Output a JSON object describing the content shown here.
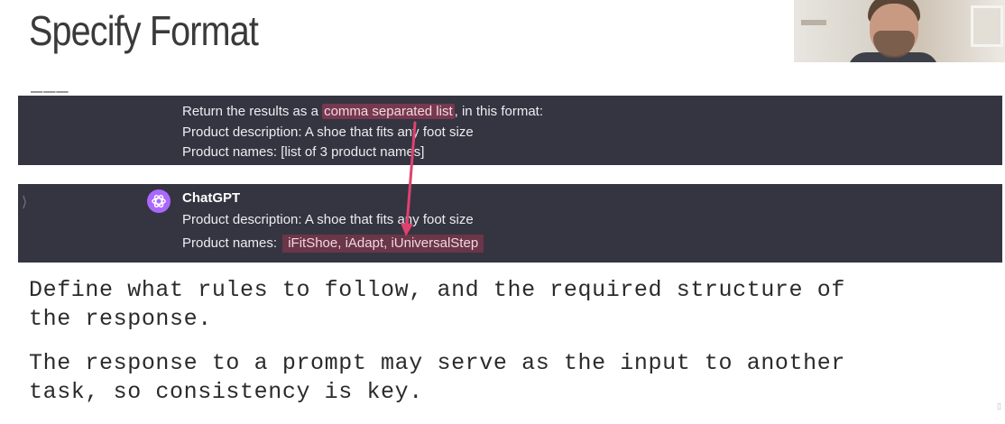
{
  "slide": {
    "title": "Specify Format",
    "rule": "___"
  },
  "user_message": {
    "line1_pre": "Return the results as a ",
    "line1_highlight": "comma separated list",
    "line1_post": ", in this format:",
    "line2": "Product description: A shoe that fits any foot size",
    "line3": "Product names: [list of 3 product names]"
  },
  "assistant_message": {
    "sidebar_glyph": "⟩",
    "sender": "ChatGPT",
    "avatar_icon": "openai-logo-icon",
    "line1": "Product description: A shoe that fits any foot size",
    "line2_label": "Product names: ",
    "line2_highlight": "iFitShoe, iAdapt, iUniversalStep"
  },
  "body": {
    "para1_line1": "Define what rules to follow, and the required structure of",
    "para1_line2": "the response.",
    "para2_line1": "The response to a prompt may serve as the input to another",
    "para2_line2": "task, so consistency is key."
  },
  "colors": {
    "panel_bg": "#353541",
    "highlight_bg": "#77394f",
    "arrow": "#e0416e",
    "avatar": "#ab68ff"
  }
}
